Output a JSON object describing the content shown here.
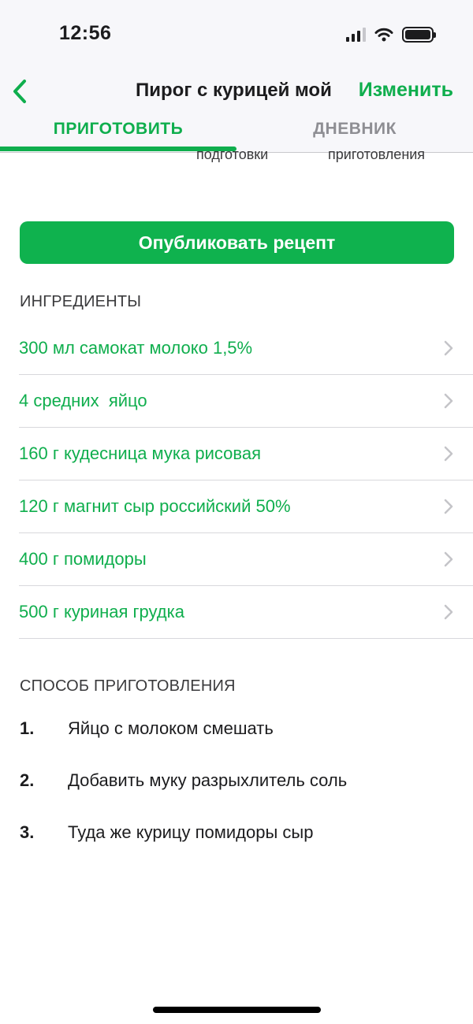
{
  "status_bar": {
    "time": "12:56"
  },
  "nav": {
    "title": "Пирог с курицей мой",
    "edit_label": "Изменить"
  },
  "tabs": [
    {
      "label": "ПРИГОТОВИТЬ",
      "active": true
    },
    {
      "label": "ДНЕВНИК",
      "active": false
    }
  ],
  "partial_labels": [
    "подготовки",
    "приготовления"
  ],
  "publish_label": "Опубликовать рецепт",
  "ingredients": {
    "header": "ИНГРЕДИЕНТЫ",
    "items": [
      "300 мл самокат молоко 1,5%",
      "4 средних  яйцо",
      "160 г кудесница мука рисовая",
      "120 г магнит сыр российский 50%",
      "400 г помидоры",
      "500 г куриная грудка"
    ]
  },
  "method": {
    "header": "СПОСОБ ПРИГОТОВЛЕНИЯ",
    "steps": [
      {
        "num": "1.",
        "text": "Яйцо с молоком смешать"
      },
      {
        "num": "2.",
        "text": "Добавить муку разрыхлитель соль"
      },
      {
        "num": "3.",
        "text": "Туда же курицу помидоры сыр"
      }
    ]
  },
  "colors": {
    "accent": "#0fae4d",
    "button": "#0fb24e",
    "header_bg": "#f7f7fa"
  },
  "icons": [
    "cellular-signal-icon",
    "wifi-icon",
    "battery-icon",
    "back-chevron-icon",
    "chevron-right-icon"
  ]
}
